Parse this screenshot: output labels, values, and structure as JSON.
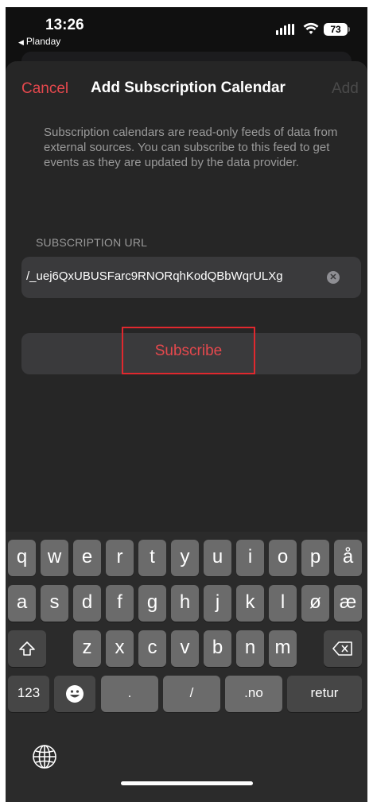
{
  "status": {
    "time": "13:26",
    "back_app": "Planday",
    "battery": "73"
  },
  "nav": {
    "cancel": "Cancel",
    "title": "Add Subscription Calendar",
    "add": "Add"
  },
  "info_text": "Subscription calendars are read-only feeds of data from external sources. You can subscribe to this feed to get events as they are updated by the data provider.",
  "url_section": {
    "label": "SUBSCRIPTION URL",
    "value": "/_uej6QxUBUSFarc9RNORqhKodQBbWqrULXg"
  },
  "subscribe_label": "Subscribe",
  "keyboard": {
    "row1": [
      "q",
      "w",
      "e",
      "r",
      "t",
      "y",
      "u",
      "i",
      "o",
      "p",
      "å"
    ],
    "row2": [
      "a",
      "s",
      "d",
      "f",
      "g",
      "h",
      "j",
      "k",
      "l",
      "ø",
      "æ"
    ],
    "row3": [
      "z",
      "x",
      "c",
      "v",
      "b",
      "n",
      "m"
    ],
    "numbers": "123",
    "dot": ".",
    "slash": "/",
    "dotno": ".no",
    "return": "retur"
  }
}
